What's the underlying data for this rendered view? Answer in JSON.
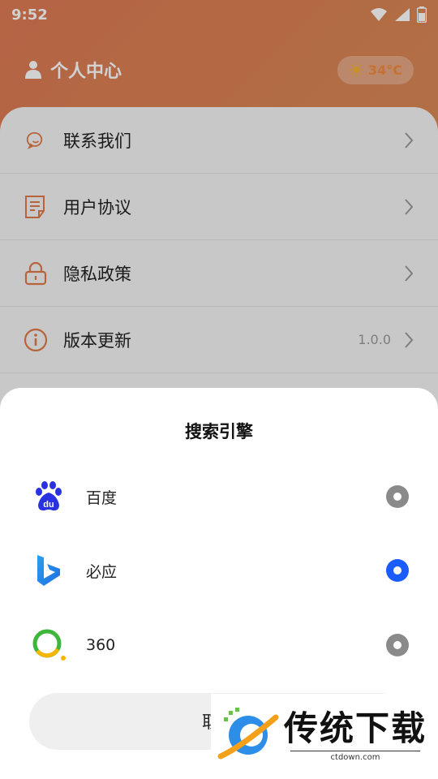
{
  "status_bar": {
    "time": "9:52"
  },
  "header": {
    "title": "个人中心",
    "temperature": "34°C"
  },
  "menu": [
    {
      "label": "联系我们",
      "icon": "chat-icon",
      "value": ""
    },
    {
      "label": "用户协议",
      "icon": "document-icon",
      "value": ""
    },
    {
      "label": "隐私政策",
      "icon": "lock-icon",
      "value": ""
    },
    {
      "label": "版本更新",
      "icon": "info-icon",
      "value": "1.0.0"
    }
  ],
  "sheet": {
    "title": "搜索引擎",
    "options": [
      {
        "name": "百度",
        "icon": "baidu-logo-icon",
        "selected": false
      },
      {
        "name": "必应",
        "icon": "bing-logo-icon",
        "selected": true
      },
      {
        "name": "360",
        "icon": "360-logo-icon",
        "selected": false
      }
    ],
    "cancel_label": "取消"
  },
  "watermark": {
    "main": "传统下载",
    "sub": "ctdown.com"
  },
  "colors": {
    "accent": "#e07a4a",
    "radio_selected": "#1a5cff",
    "radio_unselected": "#8a8a8a"
  }
}
